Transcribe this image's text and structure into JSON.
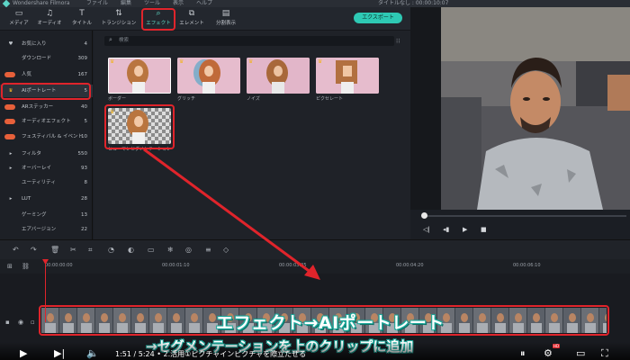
{
  "titlebar": {
    "app": "Wondershare Filmora",
    "menus": [
      "ファイル",
      "編集",
      "ツール",
      "表示",
      "ヘルプ"
    ],
    "doc": "タイトルなし : 00:00:10:07"
  },
  "toolbar": {
    "tools": [
      {
        "label": "メディア",
        "icon": "folder-icon"
      },
      {
        "label": "オーディオ",
        "icon": "music-note-icon"
      },
      {
        "label": "タイトル",
        "icon": "text-icon"
      },
      {
        "label": "トランジション",
        "icon": "transition-icon"
      },
      {
        "label": "エフェクト",
        "icon": "magic-icon"
      },
      {
        "label": "エレメント",
        "icon": "element-icon"
      },
      {
        "label": "分割表示",
        "icon": "split-screen-icon"
      }
    ],
    "export_label": "エクスポート"
  },
  "categories": [
    {
      "label": "お気に入り",
      "count": "4",
      "icon": "heart-icon"
    },
    {
      "label": "ダウンロード",
      "count": "309",
      "icon": ""
    },
    {
      "label": "人気",
      "count": "167",
      "icon": "tag-icon"
    },
    {
      "label": "AIポートレート",
      "count": "5",
      "icon": "crown-icon"
    },
    {
      "label": "ARステッカー",
      "count": "40",
      "icon": "tag-icon"
    },
    {
      "label": "オーディオエフェクト",
      "count": "5",
      "icon": "tag-icon"
    },
    {
      "label": "フェスティバル & イベント",
      "count": "10",
      "icon": "tag-icon"
    },
    {
      "label": "フィルタ",
      "count": "550",
      "icon": "triangle-icon"
    },
    {
      "label": "オーバーレイ",
      "count": "93",
      "icon": "triangle-icon"
    },
    {
      "label": "ユーティリティ",
      "count": "8",
      "icon": ""
    },
    {
      "label": "LUT",
      "count": "28",
      "icon": "triangle-icon"
    },
    {
      "label": "ゲーミング",
      "count": "13",
      "icon": ""
    },
    {
      "label": "エアバージョン",
      "count": "22",
      "icon": ""
    }
  ],
  "search": {
    "placeholder": "検索"
  },
  "effects": [
    {
      "label": "ボーダー"
    },
    {
      "label": "グリッチ"
    },
    {
      "label": "ノイズ"
    },
    {
      "label": "ピクセレート"
    },
    {
      "label": "ヒューマンセグメンテーション"
    }
  ],
  "timeline": {
    "timecodes": [
      "00:00:00:00",
      "00:00:01:10",
      "00:00:03:05",
      "00:00:04:20",
      "00:00:06:10"
    ]
  },
  "captions": {
    "line1": "エフェクト→AIポートレート",
    "line2": "→セグメンテーションを上のクリップに追加"
  },
  "player": {
    "time": "1:51 / 5:24",
    "chapter": "• 2.活用①ピクチャインピクチャを際立たせる",
    "hd_badge": "HD"
  },
  "colors": {
    "accent": "#2ec9b4",
    "highlight": "#e0242b"
  }
}
